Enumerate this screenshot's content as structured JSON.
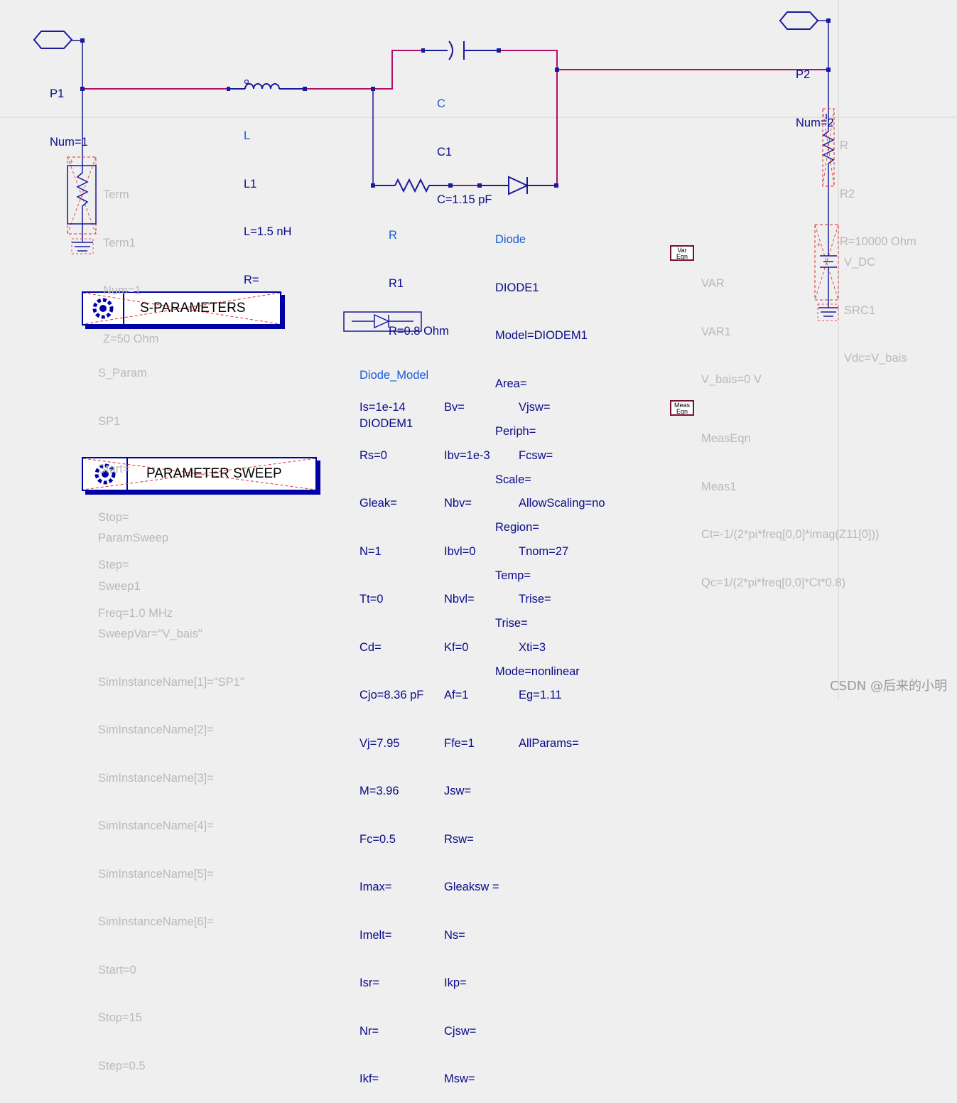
{
  "ports": {
    "p1": {
      "name": "P1",
      "num": "Num=1"
    },
    "p2": {
      "name": "P2",
      "num": "Num=2"
    }
  },
  "inductor": {
    "type": "L",
    "name": "L1",
    "params": [
      "L=1.5 nH",
      "R="
    ]
  },
  "capacitor": {
    "type": "C",
    "name": "C1",
    "params": [
      "C=1.15 pF"
    ]
  },
  "resistor_r1": {
    "type": "R",
    "name": "R1",
    "params": [
      "R=0.8 Ohm"
    ]
  },
  "diode": {
    "type": "Diode",
    "name": "DIODE1",
    "params": [
      "Model=DIODEM1",
      "Area=",
      "Periph=",
      "Scale=",
      "Region=",
      "Temp=",
      "Trise=",
      "Mode=nonlinear"
    ]
  },
  "term": {
    "type": "Term",
    "name": "Term1",
    "params": [
      "Num=1",
      "Z=50 Ohm"
    ]
  },
  "resistor_r2": {
    "type": "R",
    "name": "R2",
    "params": [
      "R=10000 Ohm"
    ]
  },
  "vdc": {
    "type": "V_DC",
    "name": "SRC1",
    "params": [
      "Vdc=V_bais"
    ]
  },
  "var": {
    "icon": [
      "Var",
      "Eqn"
    ],
    "type": "VAR",
    "name": "VAR1",
    "params": [
      "V_bais=0 V"
    ]
  },
  "meas": {
    "icon": [
      "Meas",
      "Eqn"
    ],
    "type": "MeasEqn",
    "name": "Meas1",
    "params": [
      "Ct=-1/(2*pi*freq[0,0]*imag(Z11[0]))",
      "Qc=1/(2*pi*freq[0,0]*Ct*0.8)"
    ]
  },
  "sparam": {
    "title": "S-PARAMETERS",
    "type": "S_Param",
    "name": "SP1",
    "params": [
      "Start=",
      "Stop=",
      "Step=",
      "Freq=1.0 MHz"
    ]
  },
  "sweep": {
    "title": "PARAMETER SWEEP",
    "type": "ParamSweep",
    "name": "Sweep1",
    "params": [
      "SweepVar=\"V_bais\"",
      "SimInstanceName[1]=\"SP1\"",
      "SimInstanceName[2]=",
      "SimInstanceName[3]=",
      "SimInstanceName[4]=",
      "SimInstanceName[5]=",
      "SimInstanceName[6]=",
      "Start=0",
      "Stop=15",
      "Step=0.5"
    ]
  },
  "diode_model": {
    "type": "Diode_Model",
    "name": "DIODEM1",
    "col1": [
      "Is=1e-14",
      "Rs=0",
      "Gleak=",
      "N=1",
      "Tt=0",
      "Cd=",
      "Cjo=8.36 pF",
      "Vj=7.95",
      "M=3.96",
      "Fc=0.5",
      "Imax=",
      "Imelt=",
      "Isr=",
      "Nr=",
      "Ikf="
    ],
    "col2": [
      "Bv=",
      "Ibv=1e-3",
      "Nbv=",
      "Ibvl=0",
      "Nbvl=",
      "Kf=0",
      "Af=1",
      "Ffe=1",
      "Jsw=",
      "Rsw=",
      "Gleaksw =",
      "Ns=",
      "Ikp=",
      "Cjsw=",
      "Msw="
    ],
    "col3": [
      "Vjsw=",
      "Fcsw=",
      "AllowScaling=no",
      "Tnom=27",
      "Trise=",
      "Xti=3",
      "Eg=1.11",
      "AllParams="
    ]
  },
  "watermark": "CSDN @后来的小明",
  "colors": {
    "wire": "#b0106a",
    "symbol": "#1a1a9c",
    "label_blue": "#1a5bd6",
    "label_navy": "#0a0a8a",
    "inactive": "#b9b9b9",
    "background": "#efefef"
  }
}
